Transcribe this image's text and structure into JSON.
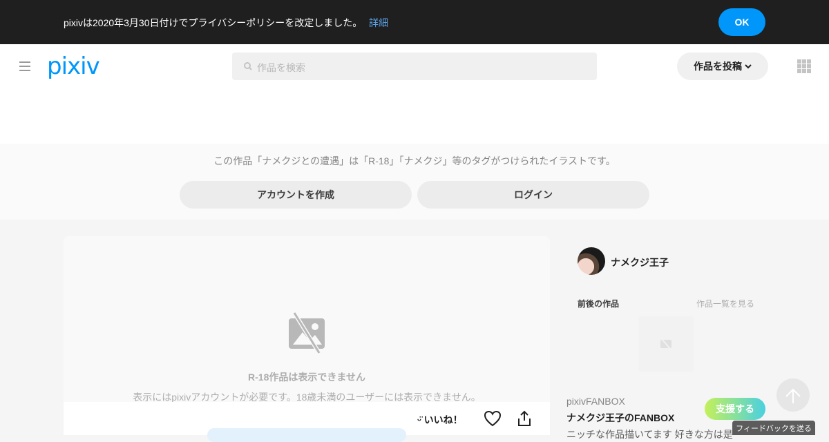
{
  "banner": {
    "text": "pixivは2020年3月30日付けでプライバシーポリシーを改定しました。",
    "link_label": "詳細",
    "ok_label": "OK"
  },
  "header": {
    "logo": "pixiv",
    "search_placeholder": "作品を検索",
    "post_label": "作品を投稿"
  },
  "notice": {
    "text": "この作品「ナメクジとの遭遇」は「R-18」「ナメクジ」等のタグがつけられたイラストです。",
    "signup_label": "アカウントを作成",
    "login_label": "ログイン"
  },
  "artwork": {
    "hidden_title": "R-18作品は表示できません",
    "hidden_desc": "表示にはpixivアカウントが必要です。18歳未満のユーザーには表示できません。",
    "like_label": "いいね！"
  },
  "sidebar": {
    "author_name": "ナメクジ王子",
    "prev_works_label": "前後の作品",
    "see_all_label": "作品一覧を見る",
    "fanbox_label": "pixivFANBOX",
    "fanbox_name": "ナメクジ王子のFANBOX",
    "fanbox_desc": "ニッチな作品描いてます 好きな方は是",
    "support_label": "支援する"
  },
  "feedback_label": "フィードバックを送る",
  "colors": {
    "accent": "#0096fa",
    "banner_bg": "#1f1f1f"
  }
}
